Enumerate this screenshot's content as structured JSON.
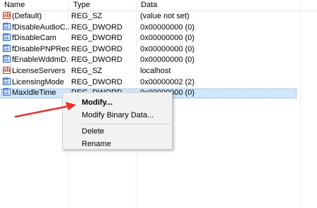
{
  "columns": {
    "name": "Name",
    "type": "Type",
    "data": "Data"
  },
  "rows": [
    {
      "icon": "string-value-icon",
      "name": "(Default)",
      "type": "REG_SZ",
      "data": "(value not set)"
    },
    {
      "icon": "dword-value-icon",
      "name": "fDisableAudioC...",
      "type": "REG_DWORD",
      "data": "0x00000000 (0)"
    },
    {
      "icon": "dword-value-icon",
      "name": "fDisableCam",
      "type": "REG_DWORD",
      "data": "0x00000000 (0)"
    },
    {
      "icon": "dword-value-icon",
      "name": "fDisablePNPRedir",
      "type": "REG_DWORD",
      "data": "0x00000000 (0)"
    },
    {
      "icon": "dword-value-icon",
      "name": "fEnableWddmD...",
      "type": "REG_DWORD",
      "data": "0x00000000 (0)"
    },
    {
      "icon": "string-value-icon",
      "name": "LicenseServers",
      "type": "REG_SZ",
      "data": "localhost"
    },
    {
      "icon": "dword-value-icon",
      "name": "LicensingMode",
      "type": "REG_DWORD",
      "data": "0x00000002 (2)"
    },
    {
      "icon": "dword-value-icon",
      "name": "MaxIdleTime",
      "type": "REG_DWORD",
      "data": "0x00000000 (0)",
      "selected": true
    }
  ],
  "context_menu": {
    "modify": "Modify...",
    "modify_binary": "Modify Binary Data...",
    "delete": "Delete",
    "rename": "Rename"
  },
  "colors": {
    "selection": "#cde8ff",
    "annotation_arrow": "#e8322f"
  }
}
